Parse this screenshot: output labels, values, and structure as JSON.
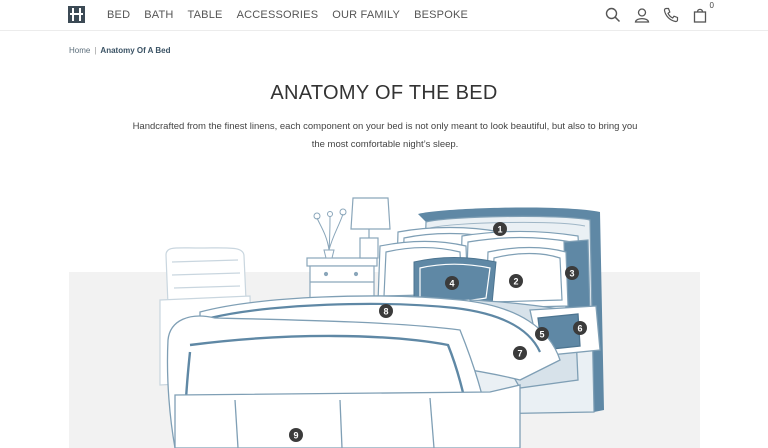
{
  "nav": {
    "logo": "logo-icon",
    "items": [
      "BED",
      "BATH",
      "TABLE",
      "ACCESSORIES",
      "OUR FAMILY",
      "BESPOKE"
    ]
  },
  "header_icons": [
    "search-icon",
    "user-icon",
    "phone-icon",
    "cart-icon"
  ],
  "cart": {
    "count": "0"
  },
  "breadcrumb": {
    "home": "Home",
    "separator": "|",
    "current": "Anatomy Of A Bed"
  },
  "page": {
    "title": "ANATOMY OF THE BED",
    "description": "Handcrafted from the finest linens, each component on your bed is not only meant to look beautiful, but also to bring you the most comfortable night’s sleep."
  },
  "hotspots": {
    "h1": "1",
    "h2": "2",
    "h3": "3",
    "h4": "4",
    "h5": "5",
    "h6": "6",
    "h7": "7",
    "h8": "8",
    "h9": "9"
  },
  "colors": {
    "accent": "#5f88a5",
    "outline": "#7f9fb5",
    "badge": "#3b3b3b",
    "floor": "#f2f2f2"
  }
}
